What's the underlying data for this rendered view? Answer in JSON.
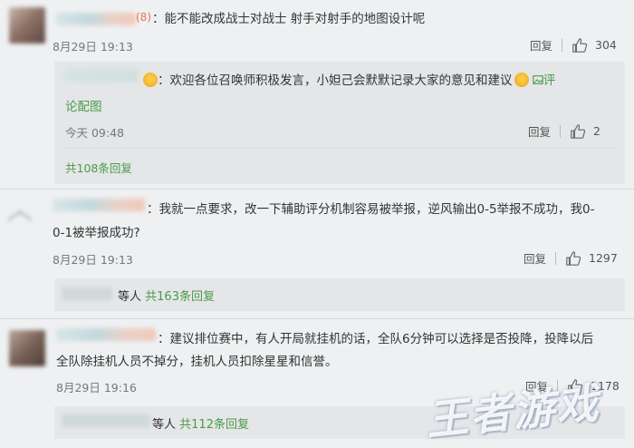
{
  "comments": [
    {
      "name_tail": "(8)",
      "text": "：能不能改成战士对战士 射手对射手的地图设计呢",
      "time": "8月29日 19:13",
      "reply_label": "回复",
      "likes": "304"
    },
    {
      "text_line1": "：我就一点要求，改一下辅助评分机制容易被举报，逆风输出0-5举报不成功，我0-",
      "text_line2": "0-1被举报成功?",
      "time": "8月29日 19:13",
      "reply_label": "回复",
      "likes": "1297"
    },
    {
      "text_line1": "：建议排位赛中，有人开局就挂机的话，全队6分钟可以选择是否投降，投降以后",
      "text_line2": "全队除挂机人员不掉分，挂机人员扣除星星和信誉。",
      "time": "8月29日 19:16",
      "reply_label": "回复",
      "likes": "1178"
    }
  ],
  "official_reply": {
    "text_a": "：欢迎各位召唤师积极发言，小妲己会默默记录大家的意见和建议",
    "text_b": "评",
    "text_line2": "论配图",
    "time": "今天 09:48",
    "reply_label": "回复",
    "likes": "2",
    "total_replies": "共108条回复"
  },
  "reply_summaries": [
    {
      "prefix": "等人",
      "count": "共163条回复"
    },
    {
      "prefix": "等人",
      "count": "共112条回复"
    }
  ],
  "watermark": "王者游戏"
}
